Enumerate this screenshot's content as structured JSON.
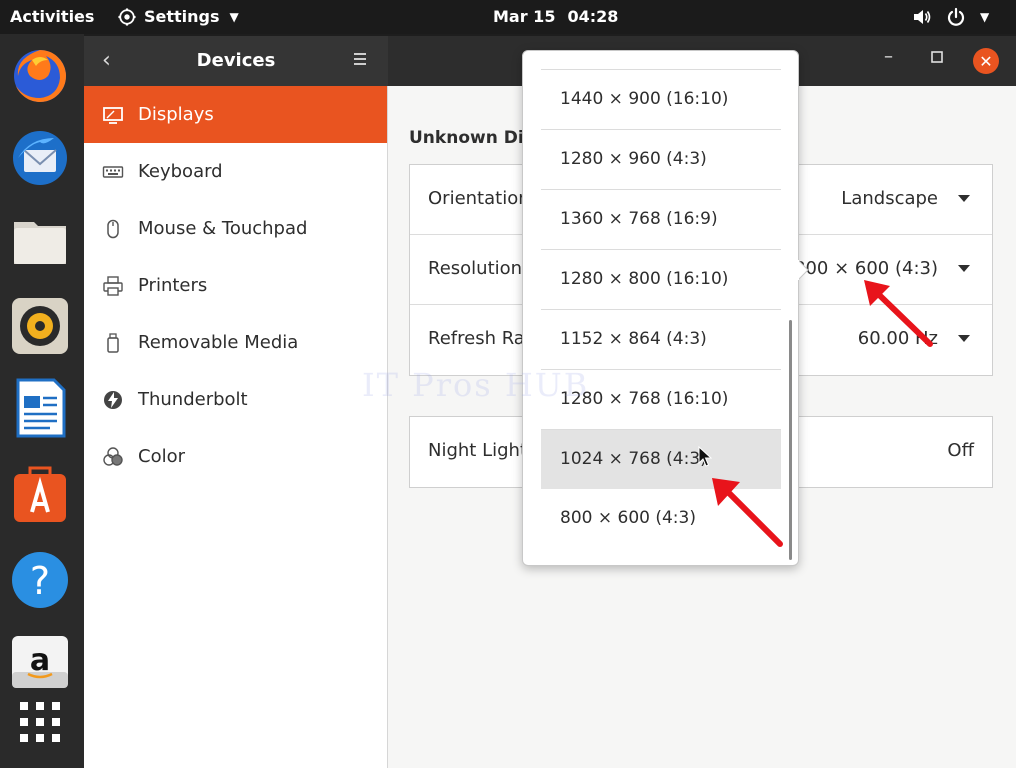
{
  "topbar": {
    "activities": "Activities",
    "app_name": "Settings",
    "date": "Mar 15",
    "time": "04:28"
  },
  "dock": {
    "apps": [
      "firefox-icon",
      "thunderbird-icon",
      "files-icon",
      "rhythmbox-icon",
      "writer-icon",
      "software-icon",
      "help-icon",
      "amazon-icon",
      "show-apps-icon"
    ]
  },
  "headerbar": {
    "title": "Devices"
  },
  "sidebar": {
    "items": [
      {
        "label": "Displays",
        "icon": "display-icon"
      },
      {
        "label": "Keyboard",
        "icon": "keyboard-icon"
      },
      {
        "label": "Mouse & Touchpad",
        "icon": "mouse-icon"
      },
      {
        "label": "Printers",
        "icon": "printer-icon"
      },
      {
        "label": "Removable Media",
        "icon": "removable-media-icon"
      },
      {
        "label": "Thunderbolt",
        "icon": "thunderbolt-icon"
      },
      {
        "label": "Color",
        "icon": "color-icon"
      }
    ]
  },
  "main": {
    "section_title": "Unknown Dis",
    "settings": [
      {
        "label": "Orientation",
        "value": "Landscape"
      },
      {
        "label": "Resolution",
        "value": "800 × 600 (4:3)"
      },
      {
        "label": "Refresh Ra",
        "value": "60.00 Hz"
      }
    ],
    "night_light": {
      "label": "Night Light",
      "value": "Off"
    }
  },
  "resolution_popover": {
    "options": [
      "1440 × 900 (16:10)",
      "1280 × 960 (4:3)",
      "1360 × 768 (16:9)",
      "1280 × 800 (16:10)",
      "1152 × 864 (4:3)",
      "1280 × 768 (16:10)",
      "1024 × 768 (4:3)",
      "800 × 600 (4:3)"
    ],
    "hovered": "1024 × 768 (4:3)"
  },
  "watermark": "IT Pros HUB",
  "colors": {
    "accent": "#e95420",
    "annotation_arrow": "#e8141b"
  }
}
